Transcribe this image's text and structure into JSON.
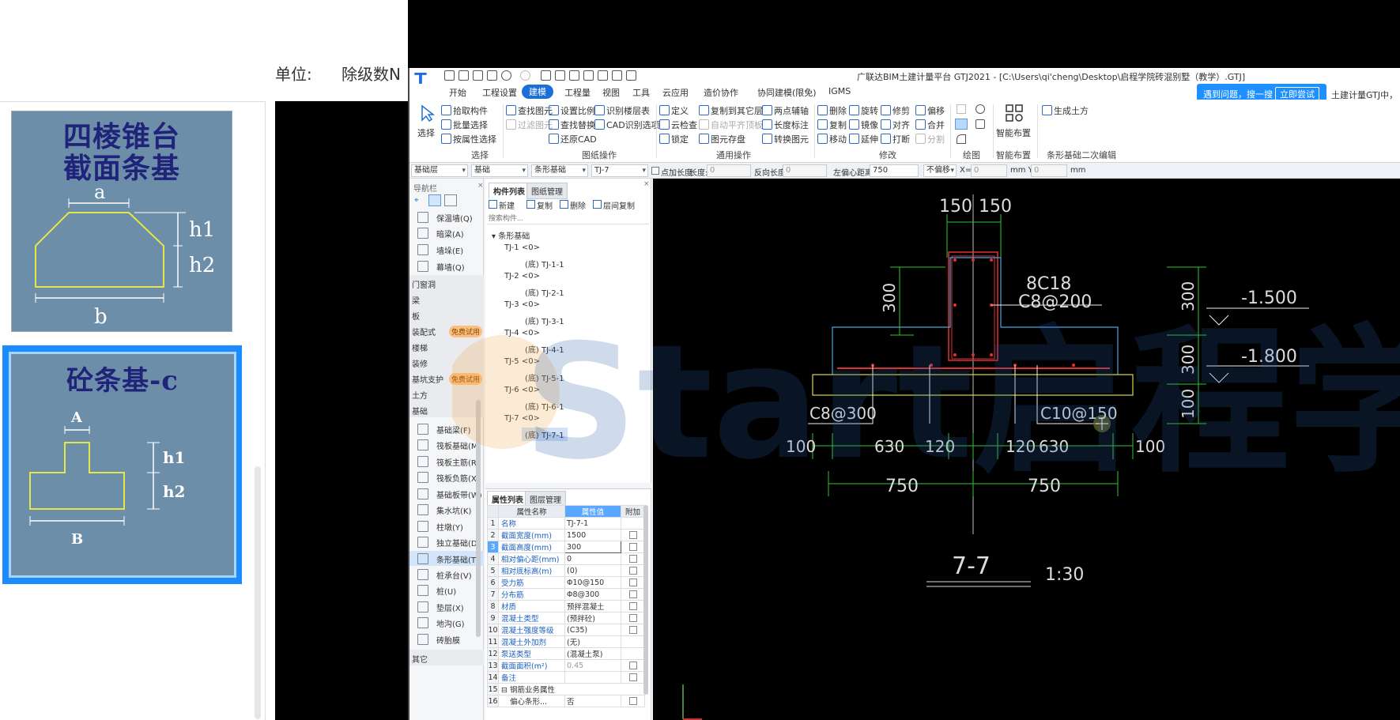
{
  "background_dialog": {
    "unit_label": "单位:",
    "unit_value": "除级数N",
    "thumbnails": [
      {
        "title_line1": "四棱锥台",
        "title_line2": "截面条基",
        "labels": [
          "a",
          "h1",
          "h2",
          "b"
        ]
      },
      {
        "title": "砼条基-c",
        "labels": [
          "A",
          "h1",
          "h2",
          "B"
        ],
        "selected": true
      }
    ]
  },
  "window": {
    "title": "广联达BIM土建计量平台 GTJ2021 - [C:\\Users\\qi'cheng\\Desktop\\启程学院砖混别墅（教学）.GTJ]"
  },
  "menu": [
    "开始",
    "工程设置",
    "建模",
    "工程量",
    "视图",
    "工具",
    "云应用",
    "造价协作",
    "协同建模(限免)",
    "IGMS"
  ],
  "menu_active_index": 2,
  "notification": {
    "text": "遇到问题，搜一搜",
    "button": "立即尝试",
    "side_text": "土建计量GTJ中，"
  },
  "ribbon": {
    "select_group": {
      "big_button": "选择",
      "items": [
        "拾取构件",
        "批量选择",
        "按属性选择"
      ],
      "label": "选择"
    },
    "drawing_ops": {
      "items": [
        "查找图元",
        "过滤图元",
        "设置比例",
        "查找替换",
        "还原CAD",
        "识别楼层表",
        "CAD识别选项"
      ],
      "label": "图纸操作"
    },
    "general_ops": {
      "items": [
        "定义",
        "云检查",
        "锁定",
        "复制到其它层",
        "自动平齐顶板",
        "图元存盘",
        "两点辅轴",
        "长度标注",
        "转换图元"
      ],
      "label": "通用操作"
    },
    "modify": {
      "items": [
        "删除",
        "复制",
        "移动",
        "旋转",
        "镜像",
        "延伸",
        "修剪",
        "对齐",
        "打断",
        "偏移",
        "合并",
        "分割"
      ],
      "label": "修改"
    },
    "draw_label": "绘图",
    "smart": {
      "big_button": "智能布置",
      "label": "智能布置"
    },
    "strip_edit": {
      "item": "生成土方",
      "label": "条形基础二次编辑"
    }
  },
  "selector_bar": {
    "floor": "基础层",
    "category": "基础",
    "type": "条形基础",
    "element": "TJ-7",
    "checkbox_label": "点加长度",
    "length_label": "长度:",
    "length_value": "0",
    "reverse_label": "反向长度:",
    "reverse_value": "0",
    "offset_label": "左偏心距离:",
    "offset_value": "750",
    "no_offset": "不偏移",
    "x_label": "X=",
    "x_value": "0",
    "mm_y": "mm Y=",
    "y_value": "0",
    "mm": "mm"
  },
  "nav": {
    "title": "导航栏",
    "top_items": [
      "保温墙(Q)",
      "暗梁(A)",
      "墙垛(E)",
      "幕墙(Q)"
    ],
    "categories_mid": [
      "门窗洞",
      "梁",
      "板"
    ],
    "decor": {
      "label": "装配式",
      "badge": "免费试用"
    },
    "categories_mid2": [
      "楼梯",
      "装修"
    ],
    "pit": {
      "label": "基坑支护",
      "badge": "免费试用"
    },
    "earth": "土方",
    "foundation": "基础",
    "foundation_items": [
      "基础梁(F)",
      "筏板基础(M)",
      "筏板主筋(R)",
      "筏板负筋(X)",
      "基础板带(W)",
      "集水坑(K)",
      "柱墩(Y)",
      "独立基础(D)",
      "条形基础(T)",
      "桩承台(V)",
      "桩(U)",
      "垫层(X)",
      "地沟(G)",
      "砖胎膜"
    ],
    "bottom": "其它"
  },
  "component_list": {
    "tabs": [
      "构件列表",
      "图纸管理"
    ],
    "tools": [
      "新建",
      "复制",
      "删除",
      "层间复制"
    ],
    "search_placeholder": "搜索构件...",
    "root": "条形基础",
    "groups": [
      {
        "name": "TJ-1 <0>",
        "child": "(底) TJ-1-1"
      },
      {
        "name": "TJ-2 <0>",
        "child": "(底) TJ-2-1"
      },
      {
        "name": "TJ-3 <0>",
        "child": "(底) TJ-3-1"
      },
      {
        "name": "TJ-4 <0>",
        "child": "(底) TJ-4-1"
      },
      {
        "name": "TJ-5 <0>",
        "child": "(底) TJ-5-1"
      },
      {
        "name": "TJ-6 <0>",
        "child": "(底) TJ-6-1"
      },
      {
        "name": "TJ-7 <0>",
        "child": "(底) TJ-7-1"
      }
    ]
  },
  "property_list": {
    "tabs": [
      "属性列表",
      "图层管理"
    ],
    "headers": [
      "属性名称",
      "属性值",
      "附加"
    ],
    "rows": [
      {
        "no": "1",
        "name": "名称",
        "value": "TJ-7-1",
        "check": false
      },
      {
        "no": "2",
        "name": "截面宽度(mm)",
        "value": "1500",
        "check": true
      },
      {
        "no": "3",
        "name": "截面高度(mm)",
        "value": "300",
        "check": true
      },
      {
        "no": "4",
        "name": "相对偏心距(mm)",
        "value": "0",
        "check": true
      },
      {
        "no": "5",
        "name": "相对底标高(m)",
        "value": "(0)",
        "check": true
      },
      {
        "no": "6",
        "name": "受力筋",
        "value": "Φ10@150",
        "check": true
      },
      {
        "no": "7",
        "name": "分布筋",
        "value": "Φ8@300",
        "check": true
      },
      {
        "no": "8",
        "name": "材质",
        "value": "预拌混凝土",
        "check": true
      },
      {
        "no": "9",
        "name": "混凝土类型",
        "value": "(预拌砼)",
        "check": true
      },
      {
        "no": "10",
        "name": "混凝土强度等级",
        "value": "(C35)",
        "check": true
      },
      {
        "no": "11",
        "name": "混凝土外加剂",
        "value": "(无)",
        "check": false
      },
      {
        "no": "12",
        "name": "泵送类型",
        "value": "(混凝土泵)",
        "check": false
      },
      {
        "no": "13",
        "name": "截面面积(m²)",
        "value": "0.45",
        "check": true
      },
      {
        "no": "14",
        "name": "备注",
        "value": "",
        "check": true
      },
      {
        "no": "15",
        "name": "⊟ 钢筋业务属性",
        "value": "",
        "check": false
      },
      {
        "no": "16",
        "name": "偏心条形...",
        "value": "否",
        "check": true
      }
    ]
  },
  "cad": {
    "dims_top": [
      "150",
      "150"
    ],
    "rebar_main": "8C18",
    "rebar_stirrup": "C8@200",
    "dims_left": [
      "300"
    ],
    "dims_right": [
      "300",
      "300",
      "100"
    ],
    "elev1": "-1.500",
    "elev2": "-1.800",
    "bar_left": "C8@300",
    "bar_right": "C10@150",
    "dims_bottom": [
      "100",
      "630",
      "120",
      "120",
      "630",
      "100"
    ],
    "dims_half": [
      "750",
      "750"
    ],
    "section_title": "7-7",
    "scale": "1:30"
  },
  "watermark": "Start启程学"
}
